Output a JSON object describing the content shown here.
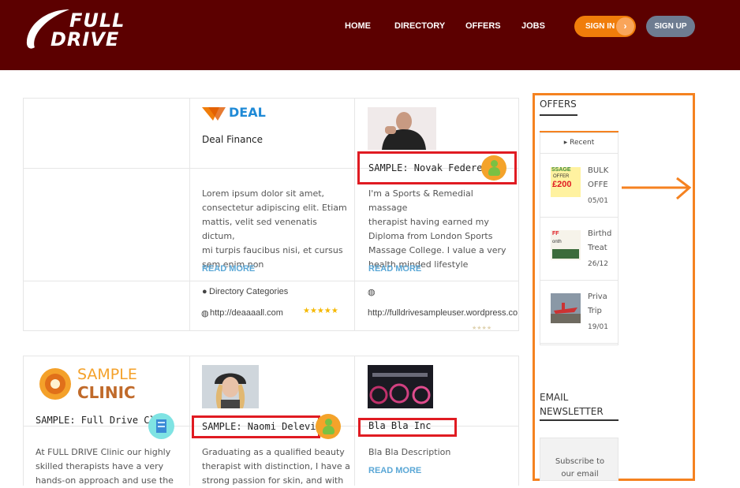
{
  "header": {
    "logo_line1": "FULL",
    "logo_line2": "DRIVE",
    "nav": [
      "HOME",
      "DIRECTORY",
      "OFFERS",
      "JOBS"
    ],
    "signin_label": "SIGN IN",
    "signin_arrow": "›",
    "signup_label": "SIGN UP"
  },
  "cards": {
    "deal": {
      "logo_text": "DEAL",
      "title": "Deal Finance",
      "desc": [
        "Lorem ipsum dolor sit amet,",
        "consectetur adipiscing elit. Etiam",
        "mattis, velit sed venenatis dictum,",
        "mi turpis faucibus nisi, et cursus",
        "sem enim non"
      ],
      "read_more": "READ MORE",
      "category": "Directory Categories",
      "url": "http://deaaaall.com",
      "stars": "★★★★★"
    },
    "novak": {
      "title": "SAMPLE: Novak Federer",
      "desc": [
        "I'm a Sports & Remedial massage",
        "therapist having earned my",
        "Diploma from London Sports",
        "Massage College. I value a very",
        "health minded lifestyle"
      ],
      "read_more": "READ MORE",
      "url": "http://fulldrivesampleuser.wordpress.com"
    },
    "clinic": {
      "logo_line1": "SAMPLE",
      "logo_line2": "CLINIC",
      "title": "SAMPLE: Full Drive Clinic",
      "desc": [
        "At FULL DRIVE Clinic our highly",
        "skilled therapists have a very",
        "hands-on approach and use the"
      ]
    },
    "naomi": {
      "title": "SAMPLE: Naomi Delevingne",
      "desc": [
        "Graduating as a qualified beauty",
        "therapist with distinction, I have a",
        "strong passion for skin, and with"
      ]
    },
    "blabla": {
      "title": "Bla Bla Inc",
      "desc": "Bla Bla Description",
      "read_more": "READ MORE"
    }
  },
  "sidebar": {
    "offers_title": "OFFERS",
    "recent_tab": "Recent",
    "offers": [
      {
        "title": [
          "BULK",
          "OFFE"
        ],
        "date": "05/01",
        "thumb_lines": [
          "SSAGE",
          "OFFER",
          "£200"
        ]
      },
      {
        "title": [
          "Birthd",
          "Treat"
        ],
        "date": "26/12",
        "thumb_lines": [
          "FF",
          "onth"
        ]
      },
      {
        "title": [
          "Priva",
          "Trip"
        ],
        "date": "19/01",
        "thumb_lines": []
      }
    ],
    "newsletter_title": [
      "EMAIL",
      "NEWSLETTER"
    ],
    "subscribe_text": [
      "Subscribe to",
      "our email"
    ]
  },
  "colors": {
    "header_bg": "#5c0000",
    "accent_orange": "#f58220",
    "signin_orange": "#f07d0a",
    "signup_gray": "#6e7c91",
    "link_blue": "#5aa7d6",
    "highlight_red": "#e01b22",
    "star_gold": "#f5b800"
  }
}
